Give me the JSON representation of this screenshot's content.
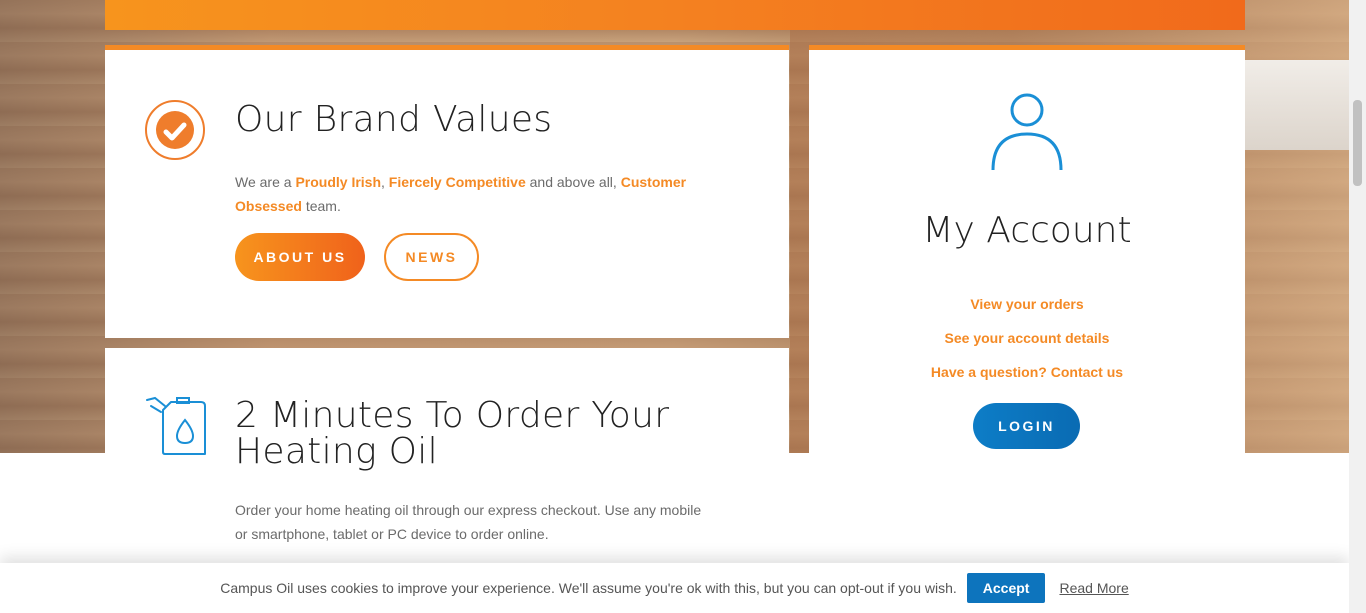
{
  "brand_values": {
    "title": "Our Brand Values",
    "text_1": "We are a ",
    "highlight_1": "Proudly Irish",
    "text_2": ", ",
    "highlight_2": "Fiercely Competitive",
    "text_3": " and above all, ",
    "highlight_3": "Customer Obsessed",
    "text_4": " team.",
    "about_label": "ABOUT US",
    "news_label": "NEWS",
    "icon": "check-circle-icon"
  },
  "order": {
    "title": "2 Minutes To Order Your Heating Oil",
    "text": "Order your home heating oil through our express checkout. Use any mobile or smartphone, tablet or PC device to order online.",
    "icon": "fuel-can-icon"
  },
  "account": {
    "title": "My Account",
    "links": [
      "View your orders",
      "See your account details",
      "Have a question? Contact us"
    ],
    "login_label": "LOGIN",
    "icon": "user-icon"
  },
  "cookie": {
    "text": "Campus Oil uses cookies to improve your experience. We'll assume you're ok with this, but you can opt-out if you wish.",
    "accept_label": "Accept",
    "read_more_label": "Read More"
  },
  "colors": {
    "accent_orange": "#f48a25",
    "accent_blue": "#0d7dc7"
  }
}
